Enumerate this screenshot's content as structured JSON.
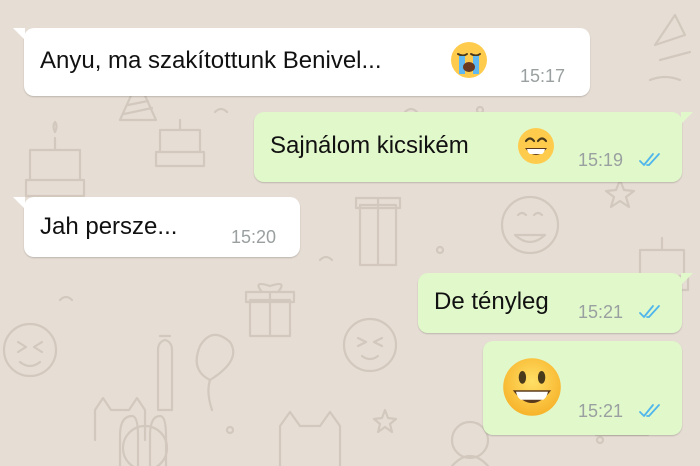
{
  "colors": {
    "incoming_bubble": "#ffffff",
    "outgoing_bubble": "#e1f8cb",
    "wallpaper": "#e6ddd4",
    "timestamp": "#9aa0a0",
    "read_ticks": "#4fb6ec"
  },
  "messages": [
    {
      "direction": "incoming",
      "text": "Anyu, ma szakítottunk Benivel...",
      "emoji": "loudly-crying-face",
      "time": "15:17"
    },
    {
      "direction": "outgoing",
      "text": "Sajnálom kicsikém",
      "emoji": "grinning-face-with-smiling-eyes",
      "time": "15:19",
      "status": "read-double-check"
    },
    {
      "direction": "incoming",
      "text": "Jah persze...",
      "time": "15:20"
    },
    {
      "direction": "outgoing",
      "text": "De tényleg",
      "time": "15:21",
      "status": "read-double-check"
    },
    {
      "direction": "outgoing",
      "text": "",
      "emoji": "grinning-face-with-big-eyes",
      "time": "15:21",
      "status": "read-double-check"
    }
  ]
}
